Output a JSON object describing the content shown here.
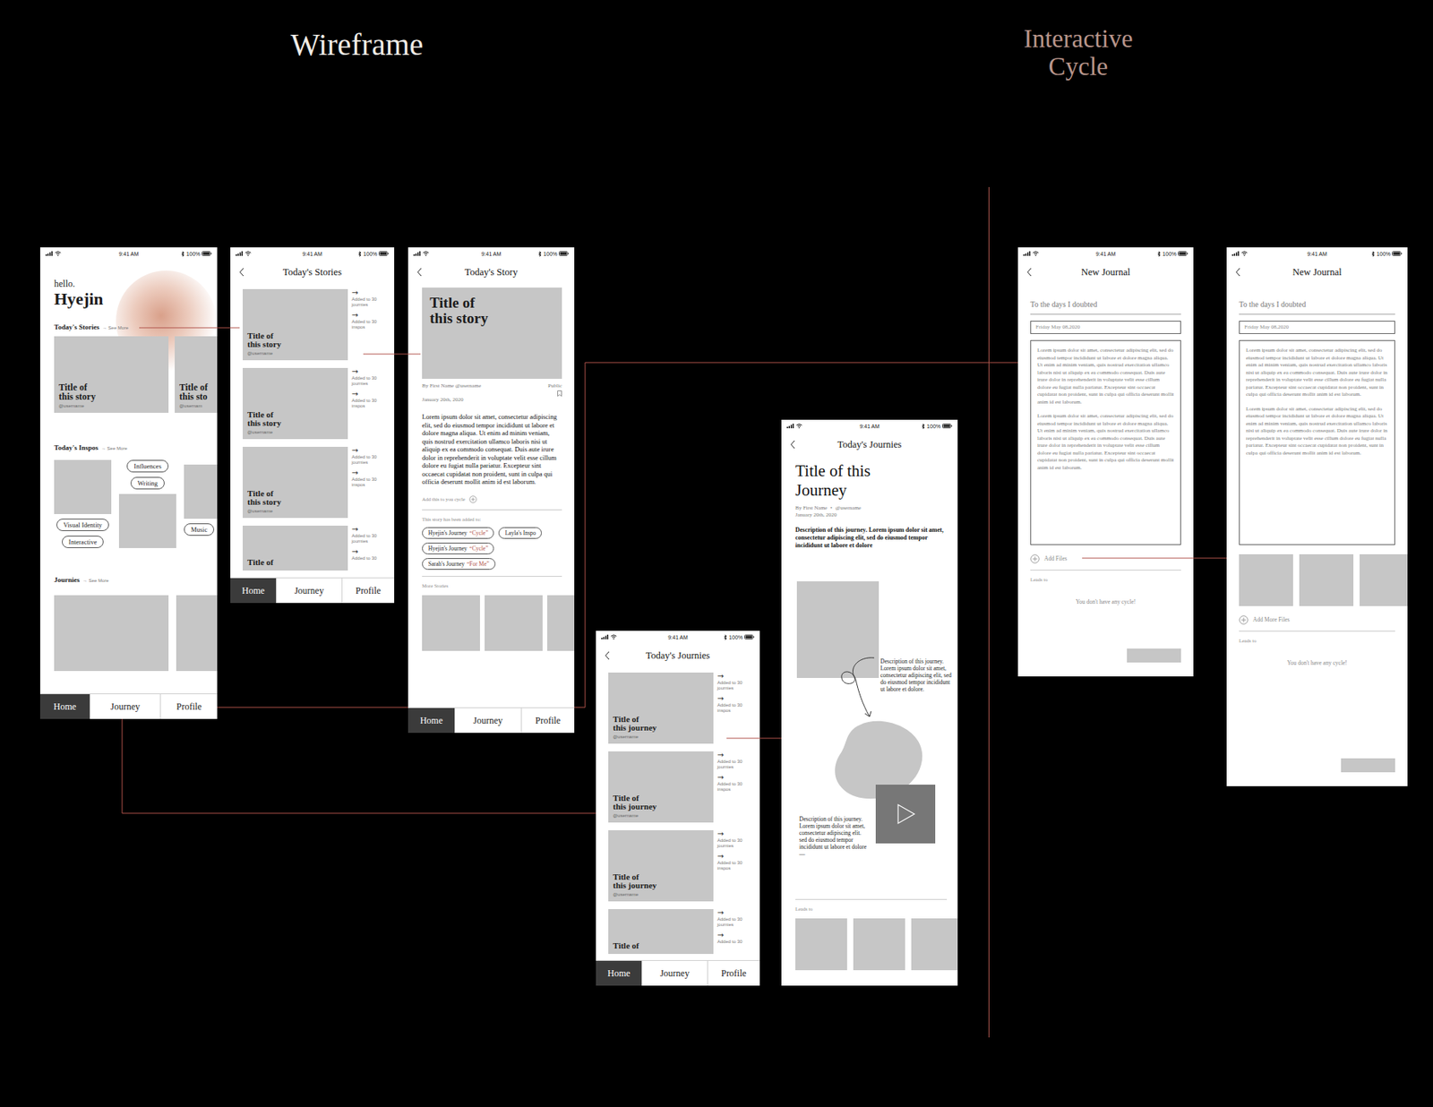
{
  "board": {
    "title": "Wireframe",
    "subtitle": "Interactive\nCycle"
  },
  "status_bar": {
    "time": "9:41 AM",
    "battery": "100%"
  },
  "nav": [
    {
      "label": "Home",
      "selected": true
    },
    {
      "label": "Journey",
      "selected": false
    },
    {
      "label": "Profile",
      "selected": false
    }
  ],
  "home": {
    "greeting": "hello.",
    "name": "Hyejin",
    "stories": {
      "heading": "Today's Stories",
      "more": "→ See More",
      "cards": [
        {
          "title": "Title of\nthis story",
          "user": "@username"
        },
        {
          "title": "Title of\nthis sto",
          "user": "@usernam"
        }
      ]
    },
    "inspos": {
      "heading": "Today's Inspos",
      "more": "→ See More",
      "column_1": [
        "Visual Identity",
        "Interactive"
      ],
      "column_2": [
        "Influences",
        "Writing"
      ],
      "column_3": [
        "Music"
      ]
    },
    "journeys": {
      "heading": "Journies",
      "more": "→ See More"
    }
  },
  "stories_list": {
    "header": "Today's Stories",
    "arrow": "→",
    "items": [
      {
        "title": "Title of\nthis story",
        "user": "@username",
        "journeys": "Added to 30 journies",
        "inspos": "Added to 30 inspos",
        "cut": false
      },
      {
        "title": "Title of\nthis story",
        "user": "@username",
        "journeys": "Added to 30 journies",
        "inspos": "Added to 30 inspos",
        "cut": false
      },
      {
        "title": "Title of\nthis story",
        "user": "@username",
        "journeys": "Added to 30 journies",
        "inspos": "Added to 30 inspos",
        "cut": false
      },
      {
        "title": "Title of",
        "journeys": "Added to 30 journies",
        "inspos": "Added to 30",
        "cut": true
      }
    ]
  },
  "story": {
    "header": "Today's Story",
    "hero": "Title of\nthis story",
    "byline": "By First Name @username",
    "visibility": "Public",
    "date": "January 20th, 2020",
    "body": "Lorem ipsum dolor sit amet, consectetur adipiscing elit, sed do eiusmod tempor incididunt ut labore et dolore magna aliqua. Ut enim ad minim veniam, quis nostrud exercitation ullamco laboris nisi ut aliquip ex ea commodo consequat. Duis aute irure dolor in reprehenderit in voluptate velit esse cillum dolore eu fugiat nulla pariatur. Excepteur sint occaecat cupidatat non proident, sunt in culpa qui officia deserunt mollit anim id est laborum.",
    "add_label": "Add this to you cycle",
    "added_heading": "This story has been added to:",
    "tags": [
      {
        "owner": "Hyejin's Journey",
        "name": "“Cycle”"
      },
      {
        "owner": "Layla's Inspo"
      },
      {
        "owner": "Hyejin's Journey",
        "name": "“Cycle”"
      },
      {
        "owner": "Sarah's Journey",
        "name": "“For Me”"
      }
    ],
    "more_heading": "More Stories"
  },
  "journeys_list": {
    "header": "Today's Journies",
    "arrow": "→",
    "items": [
      {
        "title": "Title of\nthis journey",
        "user": "@username",
        "journeys": "Added to 30 journies",
        "inspos": "Added to 30 inspos",
        "cut": false
      },
      {
        "title": "Title of\nthis journey",
        "user": "@username",
        "journeys": "Added to 30 journies",
        "inspos": "Added to 30 inspos",
        "cut": false
      },
      {
        "title": "Title of\nthis journey",
        "user": "@username",
        "journeys": "Added to 30 journies",
        "inspos": "Added to 30 inspos",
        "cut": false
      },
      {
        "title": "Title of",
        "journeys": "Added to 30 journies",
        "inspos": "Added to 30",
        "cut": true
      }
    ]
  },
  "journey": {
    "header": "Today's Journies",
    "title": "Title of this\nJourney",
    "author": "By First Name",
    "separator": "•",
    "user": "@username",
    "date": "January 20th, 2020",
    "description": "Description of this journey. Lorem ipsum dolor sit amet, consectetur adipiscing elit, sed do eiusmod tempor incididunt ut labore et dolore",
    "note_1": "Description of this journey. Lorem ipsum dolor sit amet, consectetur adipiscing elit, sed do eiusmod tempor incididunt ut labore et dolore.",
    "note_2": "Description of this journey. Lorem ipsum dolor sit amet, consectetur adipiscing elit. sed do eiusmod tempor incididunt ut labore et dolore —",
    "leads_heading": "Leads to"
  },
  "journals": [
    {
      "header": "New Journal",
      "title_value": "To the days I doubted",
      "date_value": "Friday May 08,2020",
      "paragraphs": [
        "Lorem ipsum dolor sit amet, consectetur adipiscing elit, sed do eiusmod tempor incididunt ut labore et dolore magna aliqua. Ut enim ad minim veniam, quis nostrud exercitation ullamco laboris nisi ut aliquip ex ea commodo consequat. Duis aute irure dolor in reprehenderit in voluptate velit esse cillum dolore eu fugiat nulla pariatur. Excepteur sint occaecat cupidatat non proident, sunt in culpa qui officia deserunt mollit anim id est laborum.",
        "Lorem ipsum dolor sit amet, consectetur adipiscing elit, sed do eiusmod tempor incididunt ut labore et dolore magna aliqua. Ut enim ad minim veniam, quis nostrud exercitation ullamco laboris nisi ut aliquip ex ea commodo consequat. Duis aute irure dolor in reprehenderit in voluptate velit esse cillum dolore eu fugiat nulla pariatur. Excepteur sint occaecat cupidatat non proident, sunt in culpa qui officia deserunt mollit anim id est laborum."
      ],
      "attachments": [],
      "add_label": "Add Files",
      "leads_heading": "Leads to",
      "empty_message": "You don't have any cycle!"
    },
    {
      "header": "New Journal",
      "title_value": "To the days I doubted",
      "date_value": "Friday May 08,2020",
      "paragraphs": [
        "Lorem ipsum dolor sit amet, consectetur adipiscing elit, sed do eiusmod tempor incididunt ut labore et dolore magna aliqua. Ut enim ad minim veniam, quis nostrud exercitation ullamco laboris nisi ut aliquip ex ea commodo consequat. Duis aute irure dolor in reprehenderit in voluptate velit esse cillum dolore eu fugiat nulla pariatur. Excepteur sint occaecat cupidatat non proident, sunt in culpa qui officia deserunt mollit anim id est laborum.",
        "Lorem ipsum dolor sit amet, consectetur adipiscing elit, sed do eiusmod tempor incididunt ut labore et dolore magna aliqua. Ut enim ad minim veniam, quis nostrud exercitation ullamco laboris nisi ut aliquip ex ea commodo consequat. Duis aute irure dolor in reprehenderit in voluptate velit esse cillum dolore eu fugiat nulla pariatur. Excepteur sint occaecat cupidatat non proident, sunt in culpa qui officia deserunt mollit anim id est laborum."
      ],
      "attachments": [
        {
          "kind": "image"
        },
        {
          "kind": "image"
        },
        {
          "kind": "image"
        }
      ],
      "add_label": "Add More Files",
      "leads_heading": "Leads to",
      "empty_message": "You don't have any cycle!"
    }
  ]
}
